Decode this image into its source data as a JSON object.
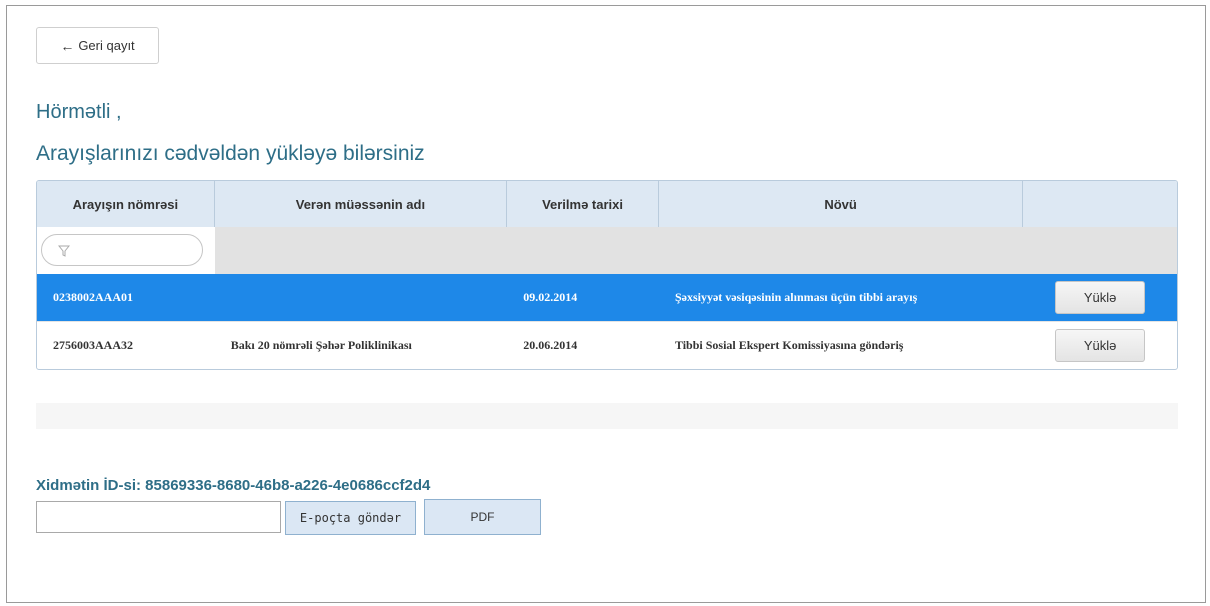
{
  "back_button": {
    "arrow": "←",
    "label": "Geri qayıt"
  },
  "greeting": "Hörmətli ,",
  "subtitle": "Arayışlarınızı cədvəldən yükləyə bilərsiniz",
  "table": {
    "columns": [
      "Arayışın nömrəsi",
      "Verən müəssənin adı",
      "Verilmə tarixi",
      "Növü",
      ""
    ],
    "filter": {
      "icon": "filter-icon",
      "value": ""
    },
    "rows": [
      {
        "number": "0238002AAA01",
        "issuer": "",
        "date": "09.02.2014",
        "type": "Şəxsiyyət vəsiqəsinin alınması üçün tibbi arayış",
        "action": "Yüklə",
        "selected": true
      },
      {
        "number": "2756003AAA32",
        "issuer": "Bakı 20 nömrəli Şəhər Poliklinikası",
        "date": "20.06.2014",
        "type": "Tibbi Sosial Ekspert Komissiyasına göndəriş",
        "action": "Yüklə",
        "selected": false
      }
    ]
  },
  "service_id": "Xidmətin İD-si: 85869336-8680-46b8-a226-4e0686ccf2d4",
  "email": {
    "value": "",
    "send_label": "E-poçta göndər"
  },
  "pdf_label": "PDF",
  "colors": {
    "accent_text": "#2e6e87",
    "selected_row": "#1e88e8",
    "header_bg": "#dde8f3"
  }
}
